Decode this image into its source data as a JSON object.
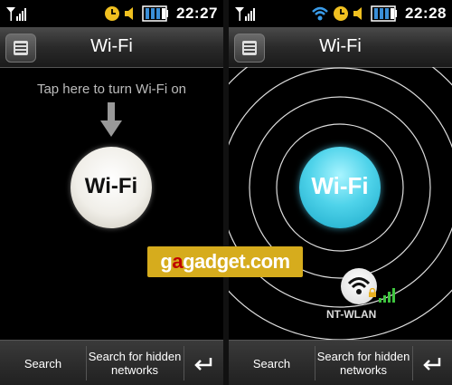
{
  "left": {
    "time": "22:27",
    "title": "Wi-Fi",
    "tap_hint": "Tap here to turn Wi-Fi on",
    "wifi_button_label": "Wi-Fi",
    "bottom": {
      "search": "Search",
      "hidden_networks": "Search for hidden networks"
    }
  },
  "right": {
    "time": "22:28",
    "title": "Wi-Fi",
    "wifi_button_label": "Wi-Fi",
    "network_name": "NT-WLAN",
    "bottom": {
      "search": "Search",
      "hidden_networks": "Search for hidden networks"
    }
  },
  "watermark": {
    "pre": "g",
    "a": "a",
    "mid": "gadget.com"
  },
  "colors": {
    "wifi_on_blue": "#4fd3ea",
    "battery_blue": "#3a8fd8",
    "clock_yellow": "#f0c020"
  }
}
